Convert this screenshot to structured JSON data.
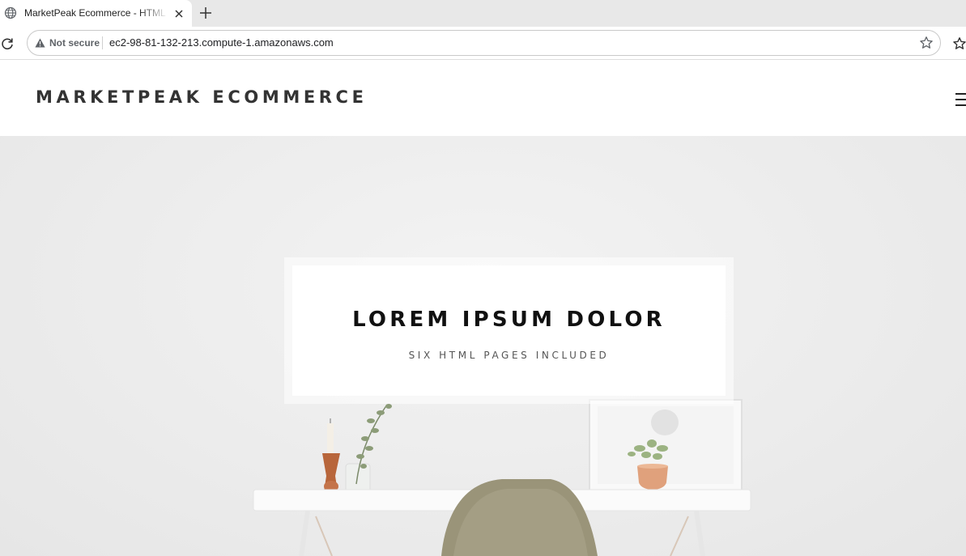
{
  "browser": {
    "tab_title": "MarketPeak Ecommerce - HTML CSS Template",
    "security_label": "Not secure",
    "url": "ec2-98-81-132-213.compute-1.amazonaws.com"
  },
  "site": {
    "brand": "MARKETPEAK ECOMMERCE"
  },
  "hero": {
    "title": "LOREM IPSUM DOLOR",
    "subtitle": "SIX HTML PAGES INCLUDED"
  },
  "icons": [
    "globe-icon",
    "close-icon",
    "plus-icon",
    "reload-icon",
    "warning-icon",
    "star-icon",
    "extensions-icon",
    "hamburger-icon"
  ]
}
